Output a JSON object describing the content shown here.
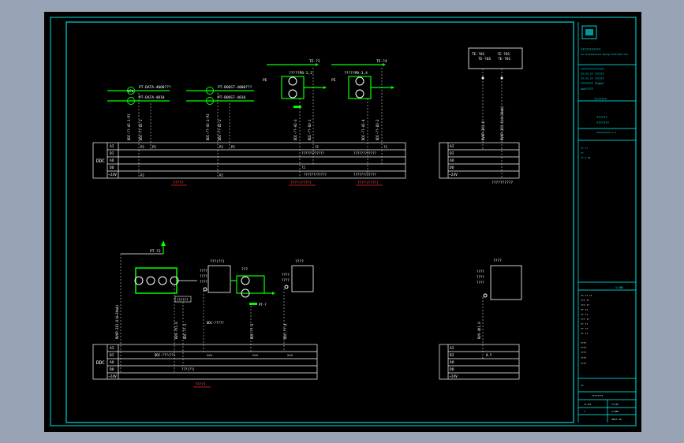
{
  "colors": {
    "background": "#98a4b6",
    "sheet": "#000000",
    "frame": "#00ffff",
    "line": "#ffffff",
    "dashed": "#cccccc",
    "equipment": "#00ff00",
    "label": "#ffffff",
    "underline": "#ff2020"
  },
  "ddc_panels": {
    "left_top_label": "DDC",
    "left_bottom_label": "DDC",
    "rows": [
      "AI",
      "DI",
      "AO",
      "DO",
      "~24V"
    ],
    "top_left_caption": "?????",
    "top_mid_caption": "????(????)",
    "top_right_caption": "????(????)",
    "top_far_caption": "??????????",
    "bottom_left_caption": "?????"
  },
  "top_left": {
    "pt1": "PT-DATA-4000???",
    "pt1b": "PT-DATA-4010",
    "pt2": "PT-BOOST-4000???",
    "pt2b": "PT-BOOST-4010",
    "vert1": "DDC-??-AI-1-P1",
    "vert2": "DDC-??-DI-1",
    "vert3": "DDC-??-AI-2-P2",
    "vert4": "DDC-??-DI-2",
    "ai_tag1": "P2",
    "ai_tag2": "P2",
    "di_tag1": "P2",
    "di_tag2": "P2",
    "pressure_sym": "kPa"
  },
  "top_mid": {
    "pump_a": "?????PB-1,2",
    "pump_b": "?????PB-3,4",
    "tag_a": "TE-?2",
    "tag_b": "TE-?4",
    "p_a": "PE",
    "p_b": "PE",
    "vert_a1": "DDC-??-AI-3",
    "vert_a2": "DDC-??-DO-1",
    "vert_b1": "DDC-??-AI-4",
    "vert_b2": "DDC-??-DO-2",
    "di_a": "?2",
    "di_b": "?2",
    "ao_a": "?2",
    "ao_b": "?2",
    "do_a": "????????????",
    "do_b": "????????????"
  },
  "top_right": {
    "box_line1": "TE-?01",
    "box_line2": "?E-?01",
    "box_line3": "TE-?01",
    "box_line4": "?E-?01",
    "vert1": "RVVP-2X1.0",
    "vert2": "RVVP-2X1.0(4~20mA)"
  },
  "bottom_left": {
    "top_tag": "PT-?2",
    "box1_title": "???(??)",
    "box2_title": "???",
    "box3_title": "????",
    "fan_tag": "??????",
    "pump_tag": "PT-?",
    "vert1": "RVVP-2X1.0(4~20mA)",
    "vert2": "RVV-?X1.0",
    "vert3": "DDC-??-2",
    "vert4": "DDC-??-3",
    "vert5": "DDC-??-4",
    "row_ai": "DDC-???(??)",
    "row_di1": "DDC-???(??)",
    "row_di2": ">>>",
    "row_di3": ">>>",
    "row_di4": ">>>",
    "row_ao": "DDC-?????",
    "row_do": "???(??)",
    "box_lines": "????"
  },
  "bottom_right": {
    "box_title": "????",
    "box_lines": "????",
    "vert1": "RVV-4X1.0",
    "row_di": "0.5"
  },
  "title_block": {
    "company": "???????????",
    "company_en": "xxx Architectural Design Institute Ltd.",
    "row1": "???????????????",
    "row2": "??:??-?? ??????",
    "row3": "??:??-?? ??????",
    "row4": "???????? Class?",
    "project": "xxx?????",
    "drawing_title": "???????",
    "drawing_sub": "??????",
    "doc_no": "xxxxxxxxxx-x.x",
    "rev_a": "?? ??",
    "rev_b": "??",
    "rev_c": "?? A.01",
    "list": [
      "?? ?? ??",
      "??? ??",
      "??? ??",
      "?? ??",
      "?? ??",
      "??? ??",
      "?? ??",
      "?? ??",
      "?? ??"
    ],
    "notes": [
      "????",
      "????",
      "????",
      "????",
      "????"
    ],
    "scale": "1:100",
    "date": "2017.12",
    "sheet": "??-01",
    "sheet_no": "??-01",
    "bottom": "????????",
    "stamp": "??",
    "stamp2": "?"
  }
}
